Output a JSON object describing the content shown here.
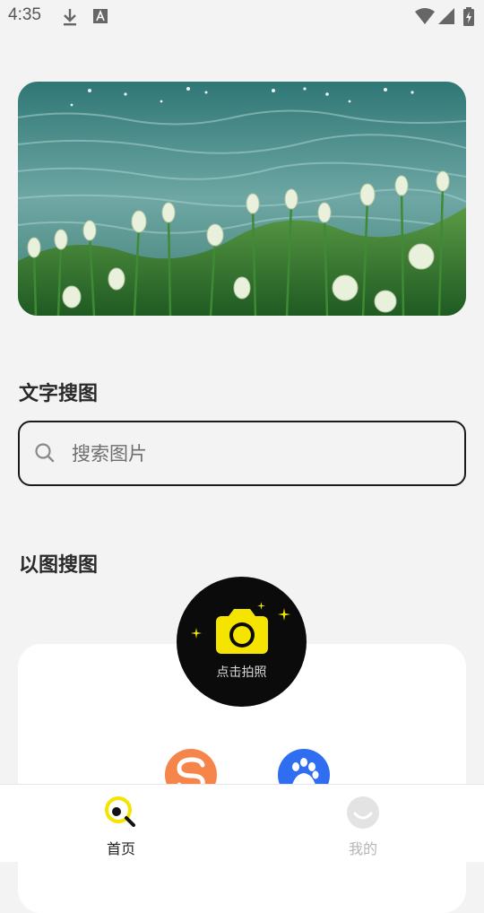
{
  "status_bar": {
    "time": "4:35"
  },
  "sections": {
    "text_search_title": "文字搜图",
    "image_search_title": "以图搜图"
  },
  "search": {
    "placeholder": "搜索图片",
    "value": ""
  },
  "camera": {
    "label": "点击拍照"
  },
  "bottom_nav": {
    "items": [
      {
        "label": "首页",
        "active": true
      },
      {
        "label": "我的",
        "active": false
      }
    ]
  },
  "colors": {
    "accent_yellow": "#f5e400",
    "background": "#f3f3f3",
    "sogou_orange": "#f5854a",
    "baidu_blue": "#2f6ef0"
  }
}
